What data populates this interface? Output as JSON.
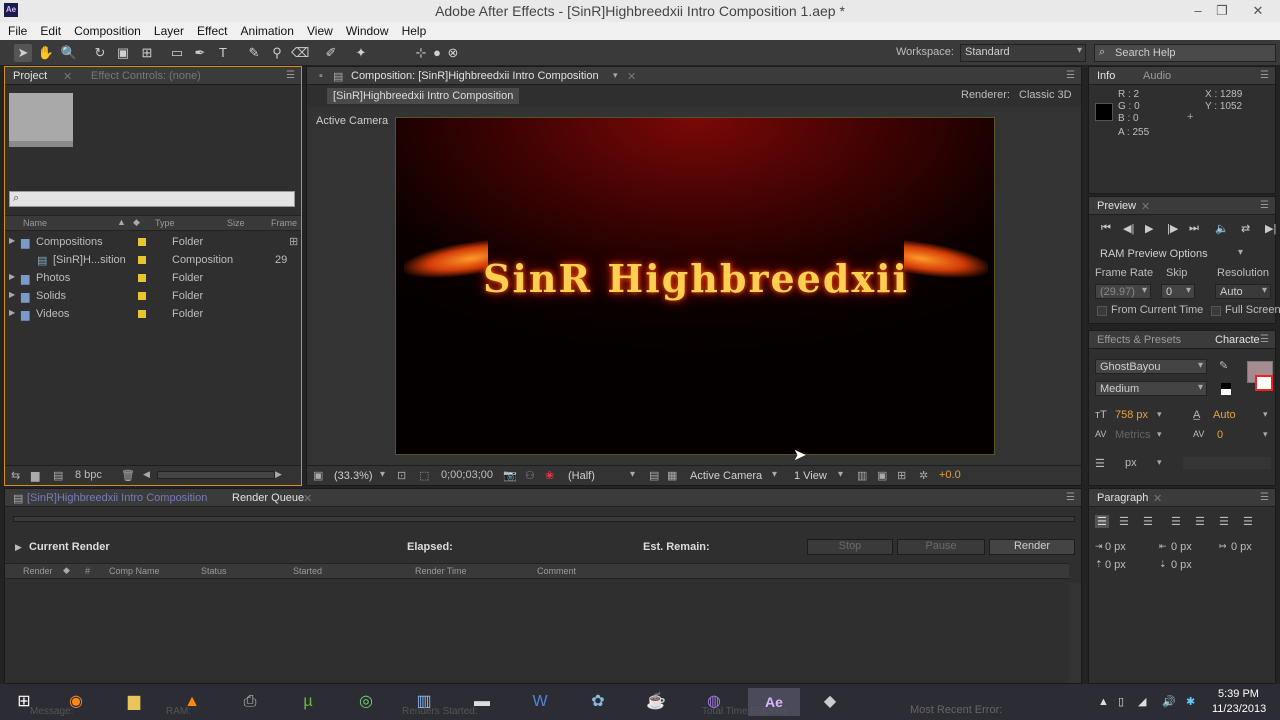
{
  "window": {
    "title": "Adobe After Effects - [SinR]Highbreedxii Intro Composition 1.aep *",
    "app_icon": "Ae"
  },
  "menu": [
    "File",
    "Edit",
    "Composition",
    "Layer",
    "Effect",
    "Animation",
    "View",
    "Window",
    "Help"
  ],
  "toolbar": {
    "workspace_label": "Workspace:",
    "workspace_value": "Standard",
    "search_placeholder": "Search Help"
  },
  "project": {
    "tab_project": "Project",
    "tab_effects": "Effect Controls: (none)",
    "columns": [
      "Name",
      "Type",
      "Size",
      "Frame"
    ],
    "items": [
      {
        "name": "Compositions",
        "type": "Folder",
        "frame": ""
      },
      {
        "name": "[SinR]H...sition",
        "type": "Composition",
        "frame": "29"
      },
      {
        "name": "Photos",
        "type": "Folder",
        "frame": ""
      },
      {
        "name": "Solids",
        "type": "Folder",
        "frame": ""
      },
      {
        "name": "Videos",
        "type": "Folder",
        "frame": ""
      }
    ],
    "bpc": "8 bpc"
  },
  "comp": {
    "tab": "Composition: [SinR]Highbreedxii Intro Composition",
    "subtab": "[SinR]Highbreedxii Intro Composition",
    "renderer_label": "Renderer:",
    "renderer": "Classic 3D",
    "camera_label": "Active Camera",
    "logo_text": "SinR Highbreedxii",
    "footer": {
      "zoom": "(33.3%)",
      "timecode": "0;00;03;00",
      "resolution": "(Half)",
      "camera": "Active Camera",
      "view": "1 View",
      "exposure": "+0.0"
    }
  },
  "info": {
    "tab_info": "Info",
    "tab_audio": "Audio",
    "r": "R : 2",
    "g": "G : 0",
    "b": "B : 0",
    "a": "A : 255",
    "x": "X : 1289",
    "y": "Y : 1052"
  },
  "preview": {
    "tab": "Preview",
    "ram": "RAM Preview Options",
    "frame_rate_label": "Frame Rate",
    "skip_label": "Skip",
    "resolution_label": "Resolution",
    "frame_rate": "(29.97)",
    "skip": "0",
    "resolution": "Auto",
    "from_current": "From Current Time",
    "full_screen": "Full Screen"
  },
  "character": {
    "tab_effects": "Effects & Presets",
    "tab_char": "Characte",
    "font": "GhostBayou",
    "style": "Medium",
    "size": "758 px",
    "leading": "Auto",
    "tracking_label": "Metrics",
    "tracking": "0",
    "unit": "px"
  },
  "paragraph": {
    "tab": "Paragraph",
    "indent": [
      "0 px",
      "0 px",
      "0 px",
      "0 px",
      "0 px"
    ]
  },
  "render": {
    "tab_comp": "[SinR]Highbreedxii Intro Composition",
    "tab_queue": "Render Queue",
    "current_render": "Current Render",
    "elapsed": "Elapsed:",
    "remain": "Est. Remain:",
    "stop": "Stop",
    "pause": "Pause",
    "render": "Render",
    "columns": [
      "Render",
      "#",
      "Comp Name",
      "Status",
      "Started",
      "Render Time",
      "Comment"
    ],
    "status_left": "Message:",
    "status_ram": "RAM:",
    "status_renders": "Renders Started:",
    "status_time": "Total Time Elapsed:",
    "status_error": "Most Recent Error:"
  },
  "taskbar": {
    "time": "5:39 PM",
    "date": "11/23/2013"
  }
}
